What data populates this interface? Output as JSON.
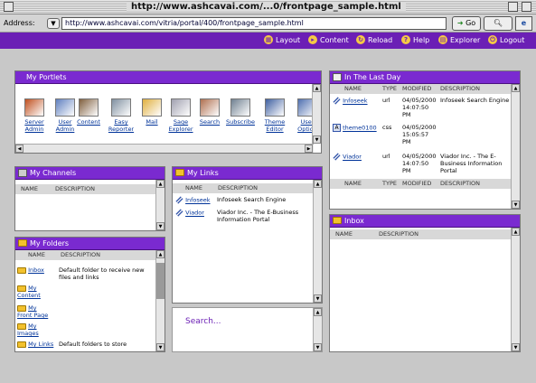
{
  "window": {
    "title": "http://www.ashcavai.com/...0/frontpage_sample.html"
  },
  "address": {
    "label": "Address:",
    "url": "http://www.ashcavai.com/vitria/portal/400/frontpage_sample.html",
    "go_label": "Go"
  },
  "nav": [
    {
      "label": "Layout",
      "icon": "layout-icon"
    },
    {
      "label": "Content",
      "icon": "content-icon"
    },
    {
      "label": "Reload",
      "icon": "reload-icon"
    },
    {
      "label": "Help",
      "icon": "help-icon"
    },
    {
      "label": "Explorer",
      "icon": "explorer-icon"
    },
    {
      "label": "Logout",
      "icon": "logout-icon"
    }
  ],
  "portlets_panel": {
    "title": "My Portlets",
    "items": [
      {
        "label": "Server\nAdmin",
        "color": "#c05020"
      },
      {
        "label": "User\nAdmin",
        "color": "#6080c0"
      },
      {
        "label": "Content",
        "color": "#806040"
      },
      {
        "label": "Easy\nReporter",
        "color": "#8090a0"
      },
      {
        "label": "Mail",
        "color": "#e0b040"
      },
      {
        "label": "Sage\nExplorer",
        "color": "#a0a0b0"
      },
      {
        "label": "Search",
        "color": "#b07050"
      },
      {
        "label": "Subscribe",
        "color": "#708090"
      },
      {
        "label": "Theme\nEditor",
        "color": "#4060a0"
      },
      {
        "label": "User\nOption",
        "color": "#5070b0"
      }
    ]
  },
  "channels_panel": {
    "title": "My Channels",
    "col_name": "NAME",
    "col_desc": "DESCRIPTION"
  },
  "links_panel": {
    "title": "My Links",
    "col_name": "NAME",
    "col_desc": "DESCRIPTION",
    "rows": [
      {
        "name": "Infoseek",
        "desc": "Infoseek Search Engine"
      },
      {
        "name": "Viador",
        "desc": "Viador Inc. - The E-Business Information Portal"
      }
    ]
  },
  "folders_panel": {
    "title": "My Folders",
    "col_name": "NAME",
    "col_desc": "DESCRIPTION",
    "rows": [
      {
        "name": "Inbox",
        "desc": "Default folder to receive new files and links"
      },
      {
        "name": "My Content",
        "desc": ""
      },
      {
        "name": "My Front Page",
        "desc": ""
      },
      {
        "name": "My Images",
        "desc": ""
      },
      {
        "name": "My Links",
        "desc": "Default folders to store"
      }
    ]
  },
  "search_panel": {
    "placeholder": "Search..."
  },
  "lastday_panel": {
    "title": "In The Last Day",
    "col_name": "NAME",
    "col_type": "TYPE",
    "col_modified": "MODIFIED",
    "col_desc": "DESCRIPTION",
    "rows": [
      {
        "name": "Infoseek",
        "type": "url",
        "modified": "04/05/2000 14:07:50 PM",
        "desc": "Infoseek Search Engine"
      },
      {
        "name": "theme0100",
        "type": "css",
        "modified": "04/05/2000 15:05:57 PM",
        "desc": ""
      },
      {
        "name": "Viador",
        "type": "url",
        "modified": "04/05/2000 14:07:50 PM",
        "desc": "Viador Inc. - The E-Business Information Portal"
      }
    ]
  },
  "inbox_panel": {
    "title": "Inbox",
    "col_name": "NAME",
    "col_desc": "DESCRIPTION"
  }
}
